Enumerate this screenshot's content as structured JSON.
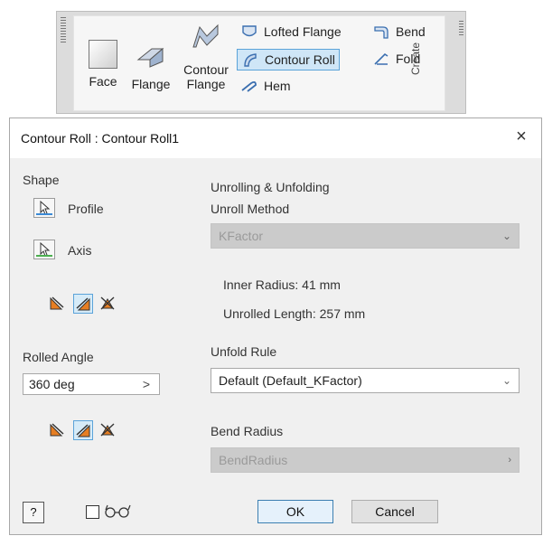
{
  "ribbon": {
    "face_label": "Face",
    "flange_label": "Flange",
    "contour_flange_label_1": "Contour",
    "contour_flange_label_2": "Flange",
    "lofted_flange_label": "Lofted Flange",
    "contour_roll_label": "Contour Roll",
    "hem_label": "Hem",
    "bend_label": "Bend",
    "fold_label": "Fold",
    "panel_title": "Create"
  },
  "dialog": {
    "title": "Contour Roll : Contour Roll1",
    "close": "×",
    "shape": {
      "heading": "Shape",
      "profile_label": "Profile",
      "axis_label": "Axis"
    },
    "rolled_angle": {
      "heading": "Rolled Angle",
      "value": "360 deg",
      "arrow": ">"
    },
    "unrolling": {
      "heading": "Unrolling & Unfolding",
      "method_label": "Unroll Method",
      "method_value": "KFactor",
      "inner_radius": "Inner Radius: 41 mm",
      "unrolled_length": "Unrolled Length: 257 mm"
    },
    "unfold_rule": {
      "label": "Unfold Rule",
      "value": "Default (Default_KFactor)"
    },
    "bend_radius": {
      "label": "Bend Radius",
      "value": "BendRadius"
    },
    "buttons": {
      "ok": "OK",
      "cancel": "Cancel",
      "help": "?"
    }
  },
  "colors": {
    "profile_underline": "#3b8ad6",
    "axis_underline": "#4caf50",
    "orange_icon": "#e67e22",
    "selection_blue": "#5ba3d9"
  }
}
